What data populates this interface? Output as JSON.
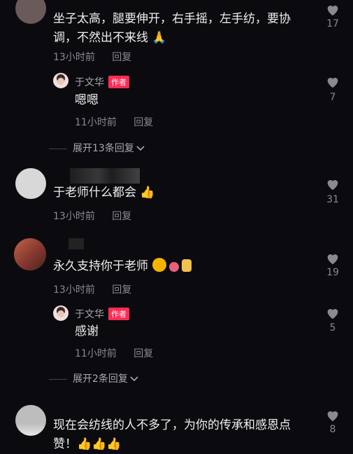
{
  "comments": [
    {
      "text_lines": [
        "坐子太高，腿要伸开，右手摇，左手纺，要协",
        "调，不然出不来线 🙏"
      ],
      "time": "13小时前",
      "reply": "回复",
      "likes": "17",
      "replies": [
        {
          "name": "于文华",
          "badge": "作者",
          "text": "嗯嗯",
          "time": "11小时前",
          "reply": "回复",
          "likes": "7"
        }
      ],
      "expand": "展开13条回复"
    },
    {
      "text": "于老师什么都会 👍",
      "time": "13小时前",
      "reply": "回复",
      "likes": "31"
    },
    {
      "text": "永久支持你于老师",
      "time": "13小时前",
      "reply": "回复",
      "likes": "19",
      "replies": [
        {
          "name": "于文华",
          "badge": "作者",
          "text": "感谢",
          "time": "11小时前",
          "reply": "回复",
          "likes": "5"
        }
      ],
      "expand": "展开2条回复"
    },
    {
      "text_lines": [
        "现在会纺线的人不多了，为你的传承和感恩点",
        "赞！👍👍👍"
      ],
      "likes": "8"
    }
  ],
  "colors": {
    "background": "#0b0b0f",
    "badge": "#fe2c55",
    "meta": "#8a8a8e"
  },
  "icons": {
    "like": "heart-icon",
    "expand": "chevron-down-icon"
  }
}
